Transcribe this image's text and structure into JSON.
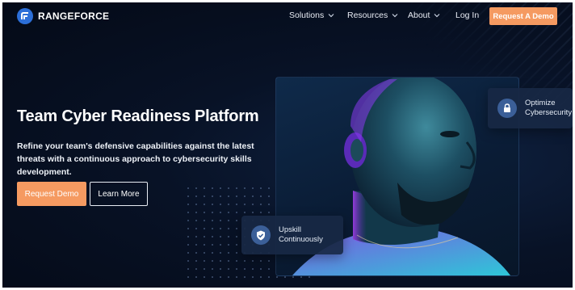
{
  "brand": {
    "name": "RANGEFORCE",
    "logo_icon": "rangeforce-logo-icon"
  },
  "nav": {
    "items": [
      {
        "label": "Solutions",
        "has_dropdown": true
      },
      {
        "label": "Resources",
        "has_dropdown": true
      },
      {
        "label": "About",
        "has_dropdown": true
      },
      {
        "label": "Log In",
        "has_dropdown": false
      }
    ],
    "cta": "Request A Demo"
  },
  "hero": {
    "title": "Team Cyber Readiness Platform",
    "subtitle": "Refine your team's defensive capabilities against the latest threats with a continuous approach to cybersecurity skills development.",
    "primary_button": "Request Demo",
    "secondary_button": "Learn More"
  },
  "cards": {
    "optimize": {
      "line1": "Optimize",
      "line2": "Cybersecurity",
      "icon": "lock-icon"
    },
    "upskill": {
      "line1": "Upskill",
      "line2": "Continuously",
      "icon": "shield-check-icon"
    }
  },
  "colors": {
    "accent": "#f59a61",
    "background": "#081226",
    "brand_blue": "#2c6fd8"
  }
}
